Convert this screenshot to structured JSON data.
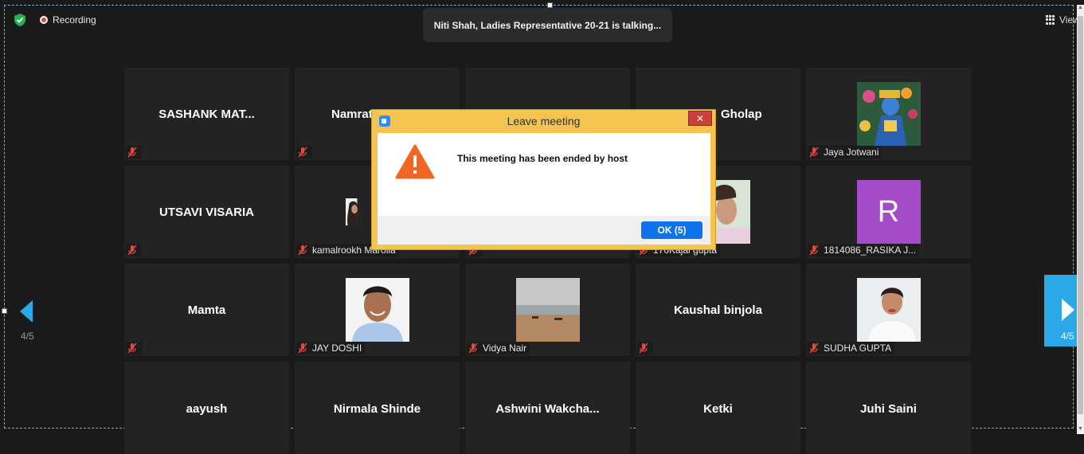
{
  "topbar": {
    "recording_label": "Recording",
    "talking_banner": "Niti Shah, Ladies Representative 20-21 is talking...",
    "view_label": "View"
  },
  "navigation": {
    "page_indicator_left": "4/5",
    "page_indicator_right": "4/5"
  },
  "tiles": [
    {
      "name": "SASHANK  MAT...",
      "label": ""
    },
    {
      "name": "Namrata",
      "label": ""
    },
    {
      "name": "",
      "label": ""
    },
    {
      "name": "Gholap",
      "label": ""
    },
    {
      "name": "",
      "label": "Jaya Jotwani"
    },
    {
      "name": "UTSAVI VISARIA",
      "label": ""
    },
    {
      "name": "",
      "label": "kamalrookh Marolia"
    },
    {
      "name": "",
      "label": ""
    },
    {
      "name": "",
      "label": "170Kajal gupta"
    },
    {
      "name": "",
      "label": "1814086_RASIKA J...",
      "avatar_letter": "R"
    },
    {
      "name": "Mamta",
      "label": ""
    },
    {
      "name": "",
      "label": "JAY DOSHI"
    },
    {
      "name": "",
      "label": "Vidya Nair"
    },
    {
      "name": "Kaushal binjola",
      "label": ""
    },
    {
      "name": "",
      "label": "SUDHA GUPTA"
    },
    {
      "name": "aayush",
      "label": ""
    },
    {
      "name": "Nirmala Shinde",
      "label": ""
    },
    {
      "name": "Ashwini  Wakcha...",
      "label": ""
    },
    {
      "name": "Ketki",
      "label": ""
    },
    {
      "name": "Juhi Saini",
      "label": ""
    }
  ],
  "dialog": {
    "title": "Leave meeting",
    "close_symbol": "✕",
    "message": "This meeting has been ended by host",
    "ok_label": "OK (5)"
  },
  "colors": {
    "background": "#1a1a1a",
    "tile": "#232323",
    "accent": "#2aa8e8",
    "dialog_frame": "#f3c44f",
    "ok_button": "#0e72ed",
    "warning": "#f26522",
    "avatar_r": "#a54bc7"
  }
}
